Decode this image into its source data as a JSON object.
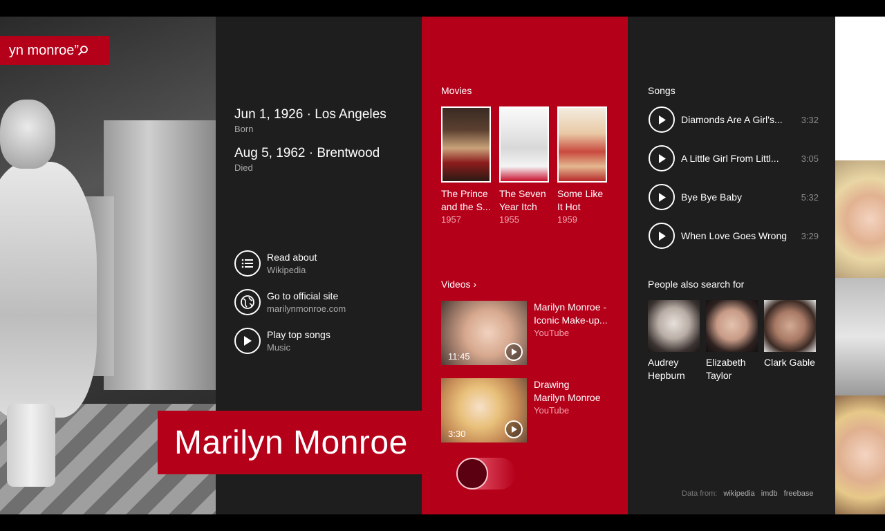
{
  "search": {
    "query_text": "yn monroe”"
  },
  "facts": [
    {
      "date": "Jun 1, 1926 · Los Angeles",
      "label": "Born"
    },
    {
      "date": "Aug 5, 1962 · Brentwood",
      "label": "Died"
    }
  ],
  "actions": [
    {
      "title": "Read about",
      "subtitle": "Wikipedia",
      "icon": "list-icon"
    },
    {
      "title": "Go to official site",
      "subtitle": "marilynmonroe.com",
      "icon": "globe-icon"
    },
    {
      "title": "Play top songs",
      "subtitle": "Music",
      "icon": "play-icon"
    }
  ],
  "name": "Marilyn Monroe",
  "movies": {
    "title": "Movies",
    "items": [
      {
        "title_line1": "The Prince",
        "title_line2": "and the S...",
        "year": "1957"
      },
      {
        "title_line1": "The Seven",
        "title_line2": "Year Itch",
        "year": "1955"
      },
      {
        "title_line1": "Some Like",
        "title_line2": "It Hot",
        "year": "1959"
      }
    ]
  },
  "videos": {
    "title": "Videos ›",
    "items": [
      {
        "line1": "Marilyn Monroe -",
        "line2": "Iconic Make-up...",
        "source": "YouTube",
        "duration": "11:45"
      },
      {
        "line1": "Drawing",
        "line2": "Marilyn Monroe",
        "source": "YouTube",
        "duration": "3:30"
      }
    ]
  },
  "songs": {
    "title": "Songs",
    "items": [
      {
        "name": "Diamonds Are A Girl's...",
        "duration": "3:32"
      },
      {
        "name": "A Little Girl From Littl...",
        "duration": "3:05"
      },
      {
        "name": "Bye Bye Baby",
        "duration": "5:32"
      },
      {
        "name": "When Love Goes Wrong",
        "duration": "3:29"
      }
    ]
  },
  "people": {
    "title": "People also search for",
    "items": [
      {
        "line1": "Audrey",
        "line2": "Hepburn"
      },
      {
        "line1": "Elizabeth",
        "line2": "Taylor"
      },
      {
        "line1": "Clark Gable",
        "line2": ""
      }
    ]
  },
  "credits": {
    "prefix": "Data from:",
    "sources": [
      "wikipedia",
      "imdb",
      "freebase"
    ]
  },
  "colors": {
    "accent": "#b5001a",
    "panel": "#1e1e1e",
    "muted": "#a8a8a8"
  }
}
